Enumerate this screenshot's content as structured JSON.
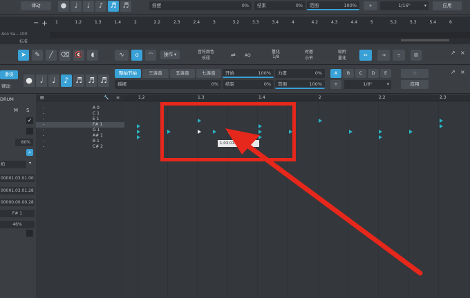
{
  "top_toolbar": {
    "rhythm_label": "律动",
    "shuffle_label": "摇摆",
    "shuffle_value": "0%",
    "length_label": "结束",
    "length_value": "0%",
    "range_label": "范围",
    "range_value": "100%",
    "quantize_value": "1/16\"",
    "apply_label": "应用"
  },
  "ruler_top": {
    "left_text": "Aco Sa...100",
    "mode": "标准",
    "ticks": [
      "1",
      "1.2",
      "1.3",
      "1.4",
      "2",
      "2.2",
      "2.3",
      "2.4",
      "3",
      "3.2",
      "3.3",
      "3.4",
      "4",
      "4.2",
      "4.3",
      "4.4",
      "5",
      "5.2",
      "5.3",
      "5.4",
      "6"
    ]
  },
  "edit_toolbar": {
    "note_color_label": "音符颜色",
    "note_color_value": "乐段",
    "quantize_label": "量化",
    "quantize_value": "1/8",
    "timebase_label": "时基",
    "timebase_value": "小节",
    "snap_label": "吸附",
    "snap_value": "量化",
    "action_label": "操作",
    "aq_label": "AQ"
  },
  "left_sidebar": {
    "tab1": "滑块",
    "tab2": "律动",
    "instrument": "DRUM",
    "m_label": "M",
    "s_label": "S",
    "volume": "80%",
    "mode": "拍",
    "pos1": "00001.03.01.00",
    "pos2": "00001.03.01.28",
    "pos3": "00000.00.00.28",
    "pitch": "F# 1",
    "velocity": "46%"
  },
  "quant_panel": {
    "tab_beats": "整拍节拍",
    "tab_triplet": "三连音",
    "tab_quint": "五连音",
    "tab_sept": "七连音",
    "shuffle_label": "摇摆",
    "shuffle_value": "0%",
    "start_label": "开始",
    "start_value": "100%",
    "length_label": "结束",
    "length_value": "0%",
    "velocity_label": "力度",
    "velocity_value": "0%",
    "range_label": "范围",
    "range_value": "100%",
    "abcde": [
      "A",
      "B",
      "C",
      "D",
      "E"
    ],
    "quantize_value": "1/8\"",
    "apply_label": "应用"
  },
  "pitch_rows": [
    "A 0",
    "C 1",
    "E 1",
    "F# 1",
    "G 1",
    "A# 1",
    "B 1",
    "C# 2"
  ],
  "grid_ruler_ticks": [
    "1.2",
    "1.3",
    "1.4",
    "2",
    "2.2",
    "2.3"
  ],
  "tooltip": "1.03.01.82 1.60",
  "colors": {
    "accent": "#3aa1d6",
    "note": "#2ab5c5",
    "highlight_box": "#e5281b",
    "arrow": "#e5281b"
  }
}
